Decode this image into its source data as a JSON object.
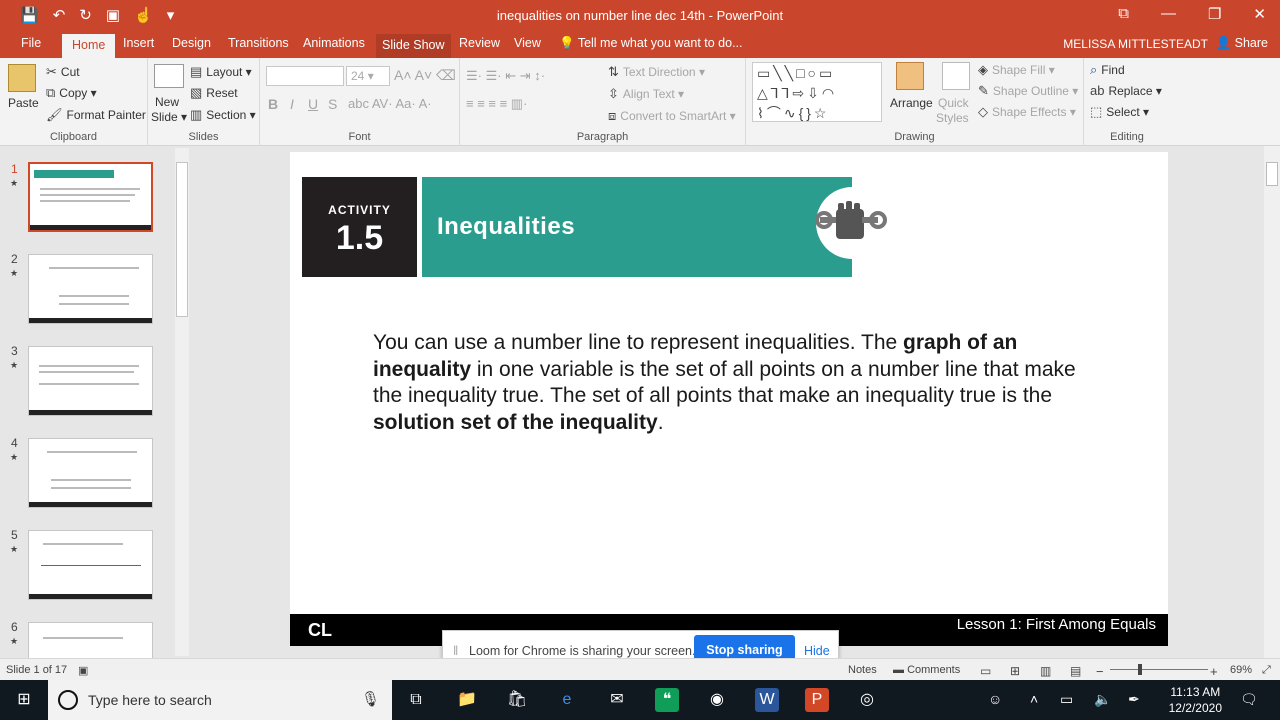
{
  "window": {
    "title": "inequalities on number line dec 14th - PowerPoint"
  },
  "tabs": {
    "file": "File",
    "home": "Home",
    "insert": "Insert",
    "design": "Design",
    "transitions": "Transitions",
    "animations": "Animations",
    "slideshow": "Slide Show",
    "review": "Review",
    "view": "View",
    "tellme": "Tell me what you want to do...",
    "user": "MELISSA MITTLESTEADT",
    "share": "Share"
  },
  "ribbon": {
    "clipboard": {
      "label": "Clipboard",
      "paste": "Paste",
      "cut": "Cut",
      "copy": "Copy",
      "format_painter": "Format Painter"
    },
    "slides": {
      "label": "Slides",
      "new_slide_1": "New",
      "new_slide_2": "Slide",
      "layout": "Layout",
      "reset": "Reset",
      "section": "Section"
    },
    "font": {
      "label": "Font",
      "size": "24"
    },
    "paragraph": {
      "label": "Paragraph",
      "text_direction": "Text Direction",
      "align_text": "Align Text",
      "convert_smartart": "Convert to SmartArt"
    },
    "drawing": {
      "label": "Drawing",
      "arrange": "Arrange",
      "quick_styles_1": "Quick",
      "quick_styles_2": "Styles",
      "shape_fill": "Shape Fill",
      "shape_outline": "Shape Outline",
      "shape_effects": "Shape Effects"
    },
    "editing": {
      "label": "Editing",
      "find": "Find",
      "replace": "Replace",
      "select": "Select"
    }
  },
  "thumbnails": [
    "1",
    "2",
    "3",
    "4",
    "5",
    "6"
  ],
  "slide": {
    "activity_label": "ACTIVITY",
    "activity_number": "1.5",
    "banner_title": "Inequalities",
    "para": {
      "p1": "You can use a number line to represent inequalities. The ",
      "b1": "graph of an inequality",
      "p2": " in one variable is the set of all points on a number line that make the inequality true. The set of all points that make an inequality true is the ",
      "b2": "solution set of the inequality",
      "p3": "."
    },
    "footer_logo": "CL",
    "footer_lesson": "Lesson 1: First Among Equals"
  },
  "loom": {
    "message": "Loom for Chrome is sharing your screen.",
    "stop": "Stop sharing",
    "hide": "Hide"
  },
  "status": {
    "slide_count": "Slide 1 of 17",
    "notes": "Notes",
    "comments": "Comments",
    "zoom": "69%"
  },
  "taskbar": {
    "search_placeholder": "Type here to search",
    "time": "11:13 AM",
    "date": "12/2/2020"
  },
  "colors": {
    "accent": "#c9462c",
    "teal": "#2a9d8f",
    "loom_button": "#1a73e8"
  }
}
